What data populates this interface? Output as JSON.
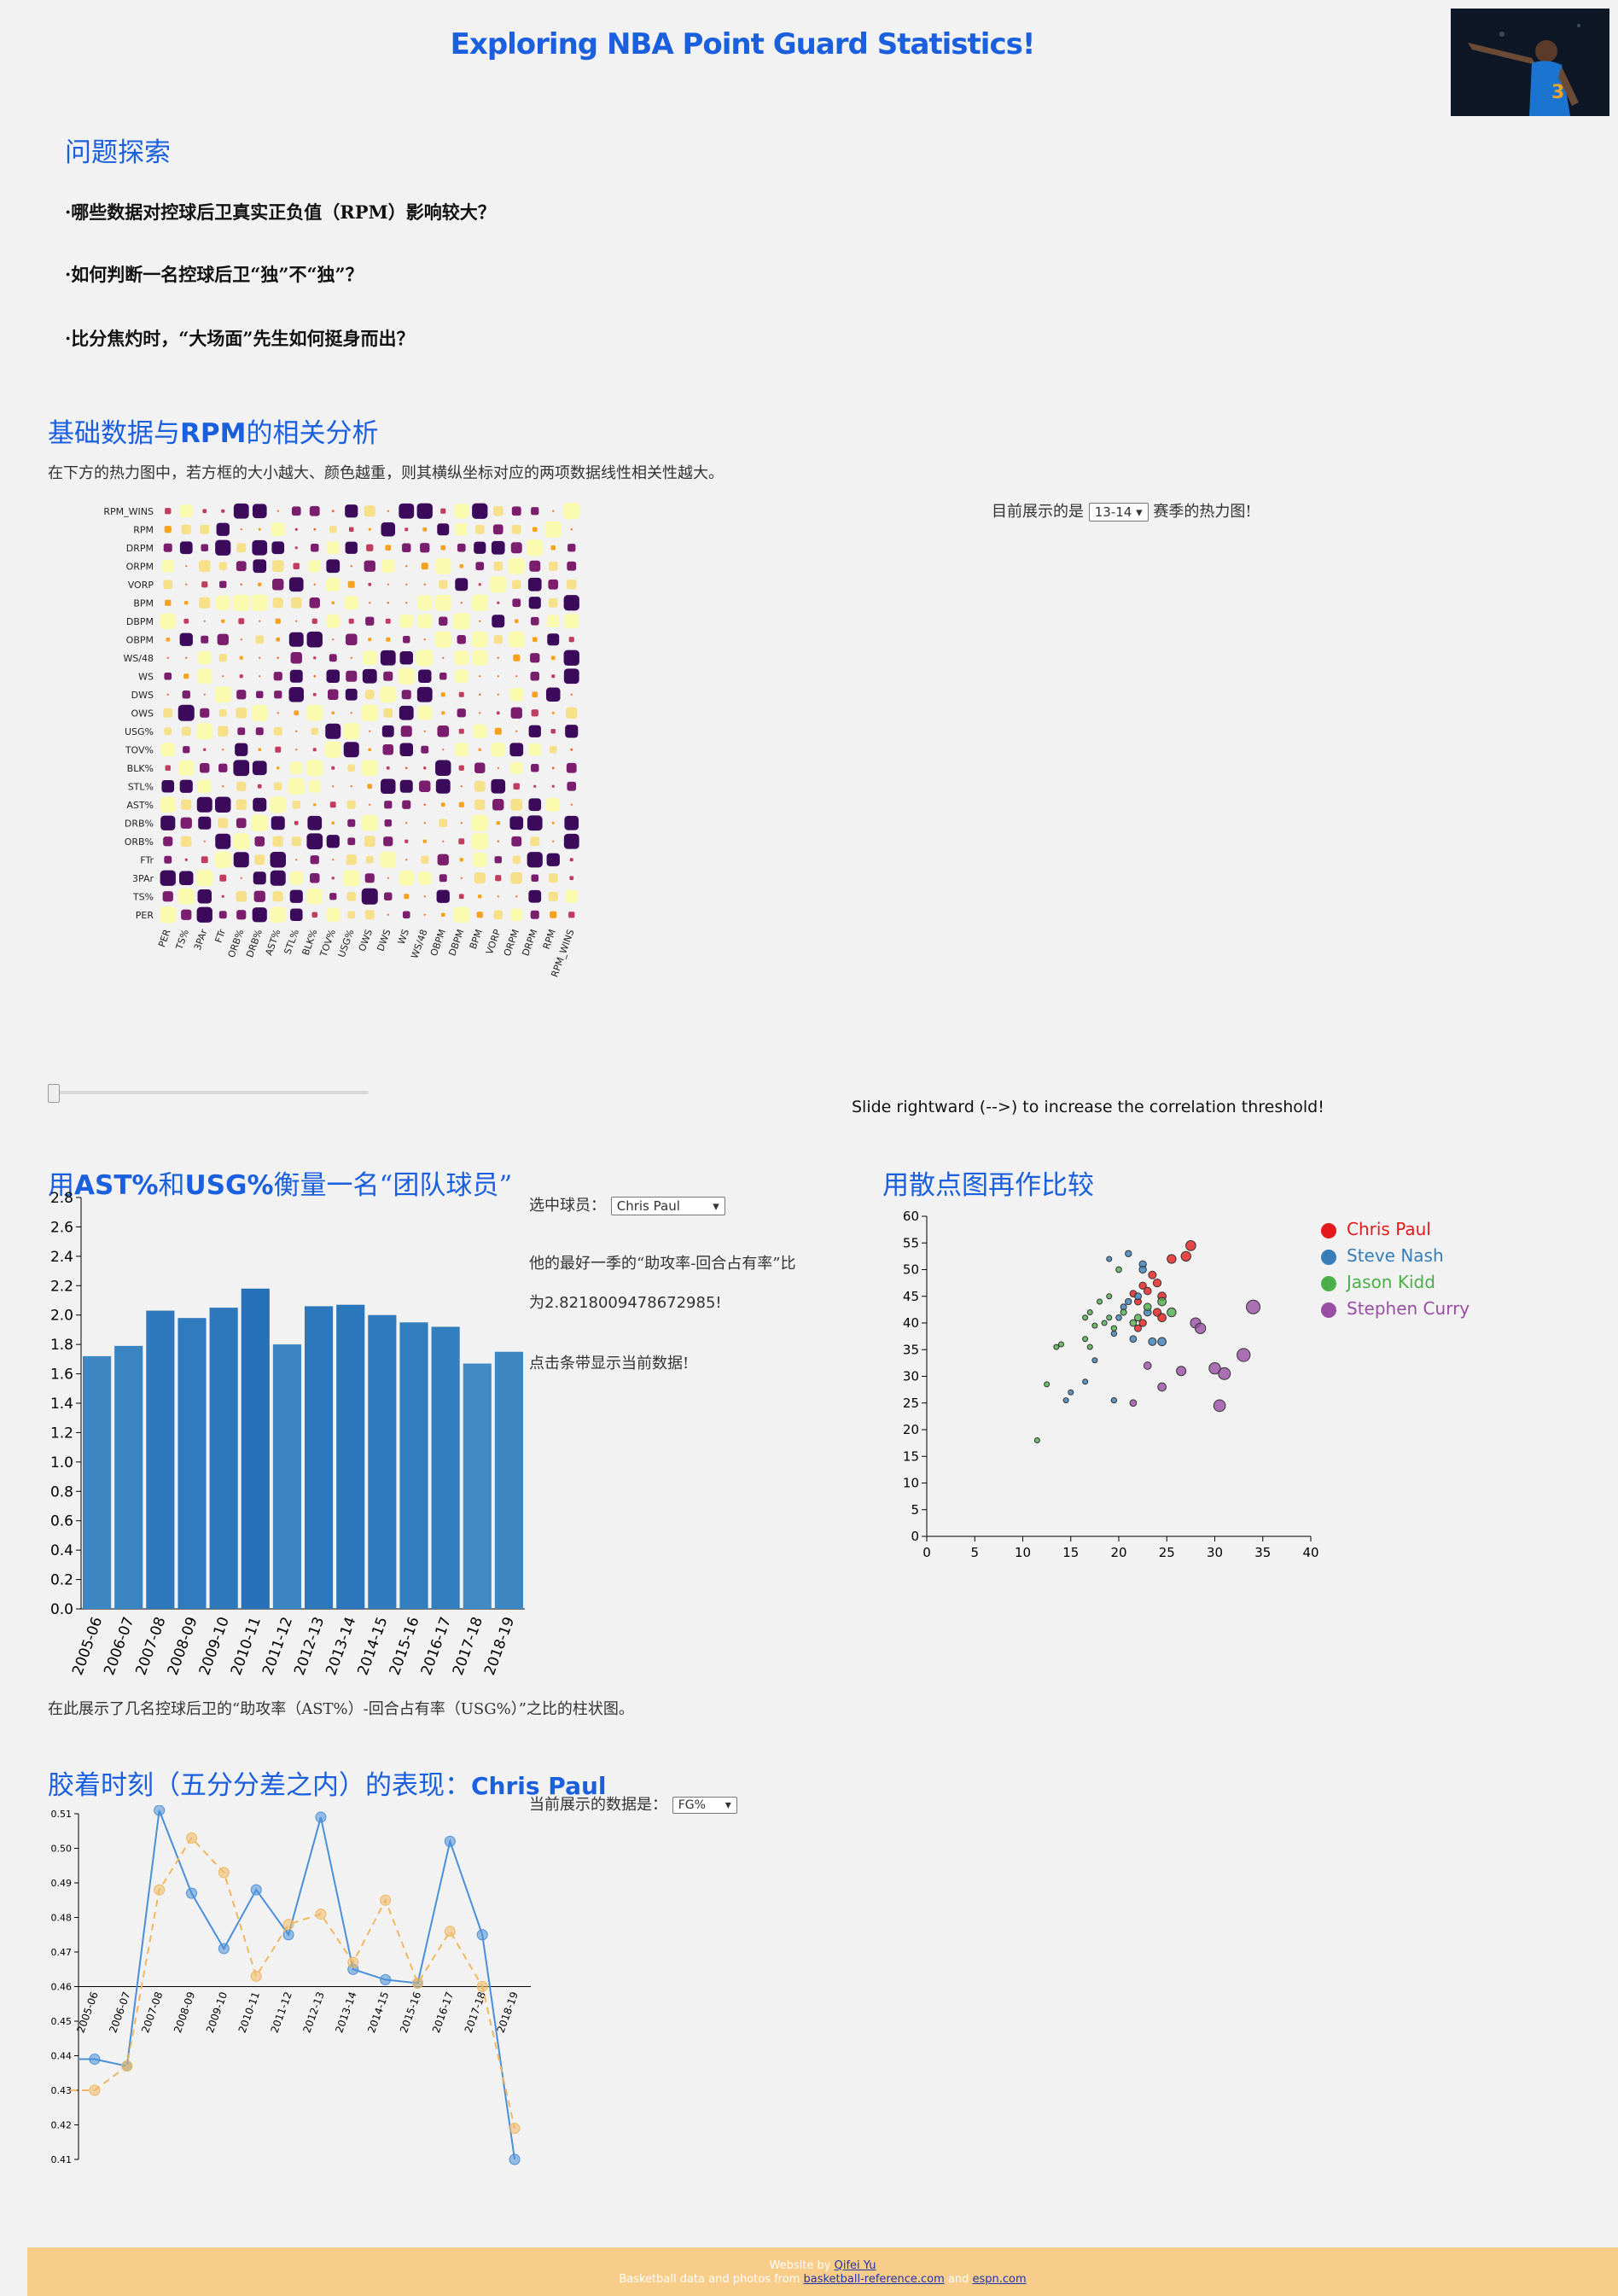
{
  "header": {
    "title": "Exploring NBA Point Guard Statistics!"
  },
  "questions": {
    "heading": "问题探索",
    "items": [
      "·哪些数据对控球后卫真实正负值（RPM）影响较大？",
      "·如何判断一名控球后卫“独”不“独”？",
      "·比分焦灼时，“大场面”先生如何挺身而出？"
    ]
  },
  "heatmap_section": {
    "heading_pre": "基础数据与",
    "heading_bold": "RPM",
    "heading_post": "的相关分析",
    "description": "在下方的热力图中，若方框的大小越大、颜色越重，则其横纵坐标对应的两项数据线性相关性越大。",
    "season_label_pre": "目前展示的是",
    "season_selected": "13-14",
    "season_label_post": "赛季的热力图!",
    "slider_caption": "Slide rightward (-->) to increase the correlation threshold!",
    "slider_value": 0
  },
  "bar_section": {
    "heading_pre": "用",
    "heading_bold": "AST%",
    "heading_mid": "和",
    "heading_bold2": "USG%",
    "heading_post": "衡量一名“团队球员”",
    "player_label": "选中球员：",
    "player_selected": "Chris Paul",
    "best_text_1": "他的最好一季的“助攻率-回合占有率”比",
    "best_text_2": "为2.8218009478672985!",
    "hint": "点击条带显示当前数据!",
    "caption": "在此展示了几名控球后卫的“助攻率（AST%）-回合占有率（USG%）”之比的柱状图。"
  },
  "scatter_section": {
    "heading": "用散点图再作比较",
    "legend": [
      {
        "name": "Chris Paul",
        "color": "#e31a1c"
      },
      {
        "name": "Steve Nash",
        "color": "#377eb8"
      },
      {
        "name": "Jason Kidd",
        "color": "#4daf4a"
      },
      {
        "name": "Stephen Curry",
        "color": "#984ea3"
      }
    ]
  },
  "clutch_section": {
    "heading_pre": "胶着时刻（五分分差之内）的表现：",
    "heading_player": "Chris Paul",
    "data_label": "当前展示的数据是：",
    "data_selected": "FG%"
  },
  "footer": {
    "line1_pre": "Website by ",
    "line1_link": "Qifei Yu",
    "line2_pre": "Basketball data and photos from ",
    "line2_link1": "basketball-reference.com",
    "line2_mid": " and ",
    "line2_link2": "espn.com"
  },
  "chart_data": [
    {
      "type": "heatmap",
      "title": "",
      "rows": [
        "RPM_WINS",
        "RPM",
        "DRPM",
        "ORPM",
        "VORP",
        "BPM",
        "DBPM",
        "OBPM",
        "WS/48",
        "WS",
        "DWS",
        "OWS",
        "USG%",
        "TOV%",
        "BLK%",
        "STL%",
        "AST%",
        "DRB%",
        "ORB%",
        "FTr",
        "3PAr",
        "TS%",
        "PER"
      ],
      "columns": [
        "PER",
        "TS%",
        "3PAr",
        "FTr",
        "ORB%",
        "DRB%",
        "AST%",
        "STL%",
        "BLK%",
        "TOV%",
        "USG%",
        "OWS",
        "DWS",
        "WS",
        "WS/48",
        "OBPM",
        "DBPM",
        "BPM",
        "VORP",
        "ORPM",
        "DRPM",
        "RPM",
        "RPM_WINS"
      ],
      "value_range": [
        -1,
        1
      ]
    },
    {
      "type": "bar",
      "categories": [
        "2005-06",
        "2006-07",
        "2007-08",
        "2008-09",
        "2009-10",
        "2010-11",
        "2011-12",
        "2012-13",
        "2013-14",
        "2014-15",
        "2015-16",
        "2016-17",
        "2017-18",
        "2018-19"
      ],
      "values": [
        1.72,
        1.79,
        2.03,
        1.98,
        2.05,
        2.18,
        1.8,
        2.06,
        2.07,
        2.0,
        1.95,
        1.92,
        1.67,
        1.75
      ],
      "ylim": [
        0,
        2.8
      ],
      "yticks": [
        0.0,
        0.2,
        0.4,
        0.6,
        0.8,
        1.0,
        1.2,
        1.4,
        1.6,
        1.8,
        2.0,
        2.2,
        2.4,
        2.6,
        2.8
      ],
      "xlabel": "",
      "ylabel": ""
    },
    {
      "type": "scatter",
      "xlim": [
        0,
        40
      ],
      "ylim": [
        0,
        60
      ],
      "xticks": [
        0,
        5,
        10,
        15,
        20,
        25,
        30,
        35,
        40
      ],
      "yticks": [
        0,
        5,
        10,
        15,
        20,
        25,
        30,
        35,
        40,
        45,
        50,
        55,
        60
      ],
      "series": [
        {
          "name": "Chris Paul",
          "points": [
            [
              27.5,
              54.5
            ],
            [
              27,
              52.5
            ],
            [
              25.5,
              52
            ],
            [
              23.5,
              49
            ],
            [
              24,
              47.5
            ],
            [
              22.5,
              47
            ],
            [
              23,
              46
            ],
            [
              21.5,
              45.5
            ],
            [
              24.5,
              45
            ],
            [
              22,
              44
            ],
            [
              24,
              42
            ],
            [
              22.5,
              40
            ],
            [
              22,
              39
            ],
            [
              24.5,
              41
            ]
          ]
        },
        {
          "name": "Steve Nash",
          "points": [
            [
              21,
              53
            ],
            [
              22.5,
              51
            ],
            [
              22.5,
              50
            ],
            [
              19,
              52
            ],
            [
              22,
              45
            ],
            [
              21,
              44
            ],
            [
              20.5,
              43
            ],
            [
              23,
              42
            ],
            [
              20,
              41
            ],
            [
              19.5,
              38
            ],
            [
              17.5,
              33
            ],
            [
              23.5,
              36.5
            ],
            [
              24.5,
              36.5
            ],
            [
              21.5,
              37
            ],
            [
              15,
              27
            ],
            [
              14.5,
              25.5
            ],
            [
              19.5,
              25.5
            ],
            [
              16.5,
              29
            ]
          ]
        },
        {
          "name": "Jason Kidd",
          "points": [
            [
              20,
              50
            ],
            [
              19,
              45
            ],
            [
              18,
              44
            ],
            [
              17,
              42
            ],
            [
              16.5,
              41
            ],
            [
              19,
              41
            ],
            [
              20.5,
              42
            ],
            [
              21.5,
              40
            ],
            [
              22,
              41
            ],
            [
              23,
              43
            ],
            [
              25.5,
              42
            ],
            [
              24.5,
              44
            ],
            [
              18.5,
              40
            ],
            [
              19.5,
              39
            ],
            [
              17.5,
              39.5
            ],
            [
              16.5,
              37
            ],
            [
              17,
              35.5
            ],
            [
              13.5,
              35.5
            ],
            [
              14,
              36
            ],
            [
              12.5,
              28.5
            ],
            [
              11.5,
              18
            ]
          ]
        },
        {
          "name": "Stephen Curry",
          "points": [
            [
              34,
              43
            ],
            [
              28,
              40
            ],
            [
              28.5,
              39
            ],
            [
              33,
              34
            ],
            [
              30,
              31.5
            ],
            [
              31,
              30.5
            ],
            [
              26.5,
              31
            ],
            [
              23,
              32
            ],
            [
              24.5,
              28
            ],
            [
              21.5,
              25
            ],
            [
              30.5,
              24.5
            ]
          ]
        }
      ]
    },
    {
      "type": "line",
      "categories": [
        "2005-06",
        "2006-07",
        "2007-08",
        "2008-09",
        "2009-10",
        "2010-11",
        "2011-12",
        "2012-13",
        "2013-14",
        "2014-15",
        "2015-16",
        "2016-17",
        "2017-18",
        "2018-19"
      ],
      "ylim": [
        0.41,
        0.51
      ],
      "yticks": [
        0.41,
        0.42,
        0.43,
        0.44,
        0.45,
        0.46,
        0.47,
        0.48,
        0.49,
        0.5,
        0.51
      ],
      "series": [
        {
          "values": [
            0.439,
            0.437,
            0.511,
            0.487,
            0.471,
            0.488,
            0.475,
            0.509,
            0.465,
            0.462,
            0.461,
            0.502,
            0.475,
            0.41
          ],
          "color": "#4a90d9",
          "style": "solid"
        },
        {
          "values": [
            0.43,
            0.437,
            0.488,
            0.503,
            0.493,
            0.463,
            0.478,
            0.481,
            0.467,
            0.485,
            0.461,
            0.476,
            0.46,
            0.419
          ],
          "color": "#f0b860",
          "style": "dashed"
        }
      ]
    }
  ]
}
